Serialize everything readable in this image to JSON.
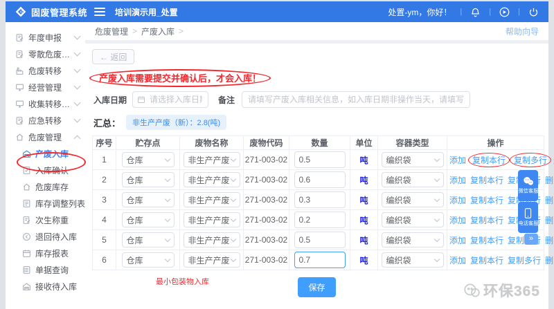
{
  "header": {
    "app_title": "固废管理系统",
    "tab": "培训演示用_处置",
    "greeting": "处置-ym，你好！",
    "icons": [
      "bell-icon",
      "broadcast-icon",
      "power-icon"
    ]
  },
  "sidebar": {
    "items": [
      {
        "label": "年度申报",
        "icon": "doc-edit-icon"
      },
      {
        "label": "零散危废收集填报",
        "icon": "doc-edit-icon"
      },
      {
        "label": "危废转移",
        "icon": "factory-icon"
      },
      {
        "label": "经营管理",
        "icon": "monitor-icon"
      },
      {
        "label": "收集转移联单",
        "icon": "monitor-icon"
      },
      {
        "label": "应急转移",
        "icon": "doc-edit-icon"
      },
      {
        "label": "危废管理",
        "icon": "home-icon",
        "expanded": true
      }
    ],
    "subitems": [
      {
        "label": "产废入库",
        "icon": "warehouse-icon",
        "active": true,
        "annotated": true
      },
      {
        "label": "入库确认",
        "icon": "doc-check-icon"
      },
      {
        "label": "危废库存",
        "icon": "home-icon"
      },
      {
        "label": "库存调整列表",
        "icon": "doc-list-icon"
      },
      {
        "label": "次生称重",
        "icon": "doc-edit-icon"
      },
      {
        "label": "退回待入库",
        "icon": "arrow-left-circle-icon"
      },
      {
        "label": "库存报表",
        "icon": "calendar-icon"
      },
      {
        "label": "单据查询",
        "icon": "list-icon"
      },
      {
        "label": "接收待入库",
        "icon": "warehouse-icon"
      }
    ]
  },
  "breadcrumb": {
    "items": [
      "危废管理",
      "产废入库"
    ]
  },
  "help_link": "帮助向导",
  "toolbar": {
    "back_label": "← 返回"
  },
  "notice": "产废入库需要提交并确认后，才会入库！",
  "form": {
    "date_label": "入库日期",
    "date_placeholder": "请选择入库日期",
    "date_value": "",
    "remark_label": "备注",
    "remark_placeholder": "请填写产废入库相关信息，如入库日期非操作当天，请填写延期入库原因",
    "remark_value": ""
  },
  "summary": {
    "label": "汇总：",
    "badge": "非生产产废（新）：2.8(吨)"
  },
  "table": {
    "headers": [
      "序号",
      "贮存点",
      "废物名称",
      "废物代码",
      "数量",
      "单位",
      "容器类型",
      "操作"
    ],
    "actions": [
      "添加",
      "复制本行",
      "复制多行",
      "删除"
    ],
    "highlighted_actions": [
      "复制本行",
      "复制多行"
    ],
    "rows": [
      {
        "index": "1",
        "storage": "仓库",
        "waste_name": "非生产产废",
        "waste_code": "271-003-02",
        "quantity": "0.5",
        "unit": "吨",
        "container": "编织袋",
        "highlight": true
      },
      {
        "index": "2",
        "storage": "仓库",
        "waste_name": "非生产产废",
        "waste_code": "271-003-02",
        "quantity": "0.6",
        "unit": "吨",
        "container": "编织袋"
      },
      {
        "index": "3",
        "storage": "仓库",
        "waste_name": "非生产产废",
        "waste_code": "271-003-02",
        "quantity": "0.3",
        "unit": "吨",
        "container": "编织袋"
      },
      {
        "index": "4",
        "storage": "仓库",
        "waste_name": "非生产产废",
        "waste_code": "271-003-02",
        "quantity": "0.2",
        "unit": "吨",
        "container": "编织袋"
      },
      {
        "index": "5",
        "storage": "仓库",
        "waste_name": "非生产产废",
        "waste_code": "271-003-02",
        "quantity": "0.5",
        "unit": "吨",
        "container": "编织袋"
      },
      {
        "index": "6",
        "storage": "仓库",
        "waste_name": "非生产产废",
        "waste_code": "271-003-02",
        "quantity": "0.7",
        "unit": "吨",
        "container": "编织袋",
        "focused": true
      }
    ]
  },
  "save_button": "保存",
  "footnote": "最小包装物入库",
  "floating": {
    "wechat": "微信客服",
    "phone": "电话客服",
    "more": "»"
  },
  "watermark": "环保365",
  "colors": {
    "header_bg": "#3379e6",
    "link": "#409eff",
    "annotation_red": "#f3272c",
    "unit_blue": "#2326d9",
    "badge_bg": "#e6f1fc",
    "badge_text": "#3c8af0"
  }
}
